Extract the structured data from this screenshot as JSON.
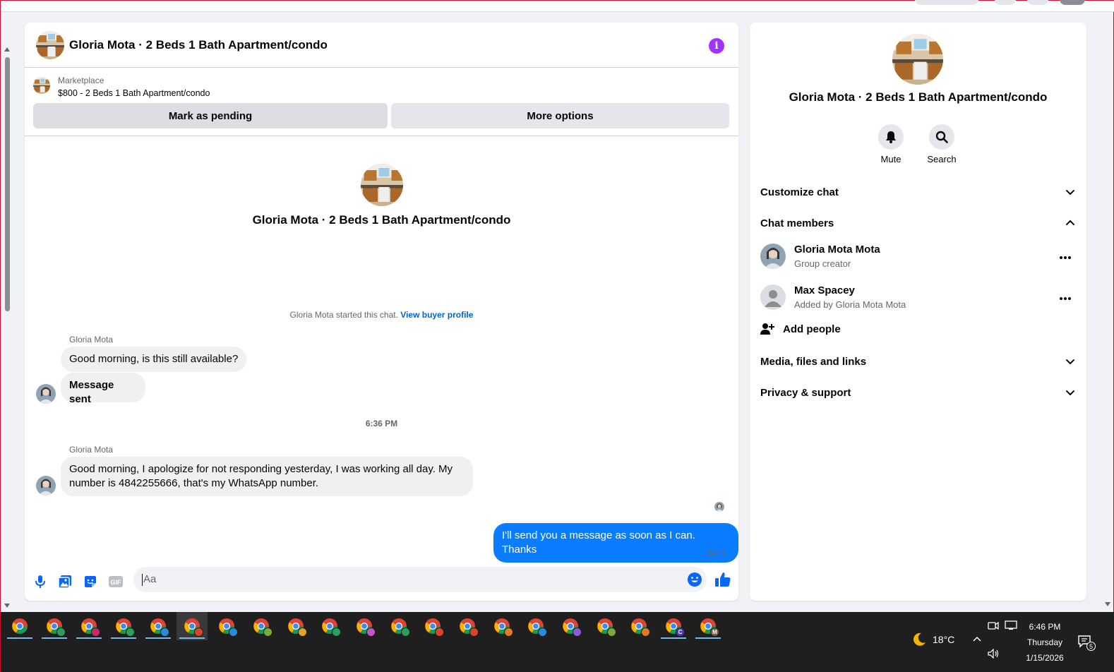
{
  "chat": {
    "header_title": "Gloria Mota · 2 Beds 1 Bath Apartment/condo",
    "marketplace_label": "Marketplace",
    "listing_price_title": "$800 - 2 Beds 1 Bath Apartment/condo",
    "mark_pending_label": "Mark as pending",
    "more_options_label": "More options",
    "intro_title": "Gloria Mota · 2 Beds 1 Bath Apartment/condo",
    "system_text": "Gloria Mota started this chat.",
    "system_link": "View buyer profile",
    "timestamp": "6:36 PM",
    "sent_status": "Sent",
    "composer_placeholder": "Aa",
    "groups": [
      {
        "sender": "Gloria Mota",
        "messages": [
          "Good morning, is this still available?",
          "Message sent"
        ]
      },
      {
        "sender": "Gloria Mota",
        "messages": [
          "Good morning, I apologize for not responding yesterday, I was working all day. My number is 4842255666, that's my WhatsApp number."
        ]
      }
    ],
    "my_message": "I'll send you a message as soon as I can. Thanks"
  },
  "info_panel": {
    "title": "Gloria Mota · 2 Beds 1 Bath Apartment/condo",
    "mute_label": "Mute",
    "search_label": "Search",
    "customize_chat": "Customize chat",
    "chat_members": "Chat members",
    "members": [
      {
        "name": "Gloria Mota Mota",
        "role": "Group creator"
      },
      {
        "name": "Max Spacey",
        "role": "Added by Gloria Mota Mota"
      }
    ],
    "add_people": "Add people",
    "media_files_links": "Media, files and links",
    "privacy_support": "Privacy & support"
  },
  "taskbar": {
    "temperature": "18°C",
    "time": "6:46 PM",
    "day": "Thursday",
    "date": "1/15/2026",
    "notification_count": "5",
    "badge_c": "C",
    "badge_m": "M"
  },
  "colors": {
    "accent_blue": "#0a7cff",
    "link_blue": "#0064d1",
    "info_purple": "#a033ff"
  }
}
